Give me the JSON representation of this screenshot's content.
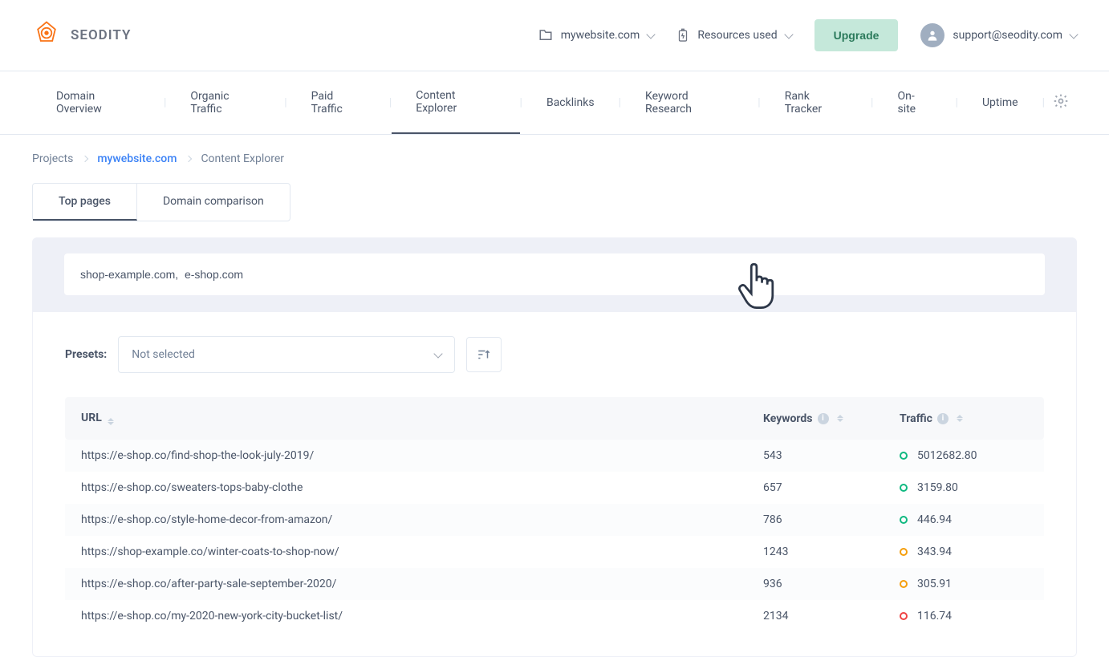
{
  "brand": "SEODITY",
  "header": {
    "domain": "mywebsite.com",
    "resources": "Resources used",
    "upgrade": "Upgrade",
    "user": "support@seodity.com"
  },
  "nav": [
    "Domain Overview",
    "Organic Traffic",
    "Paid Traffic",
    "Content Explorer",
    "Backlinks",
    "Keyword Research",
    "Rank Tracker",
    "On-site",
    "Uptime"
  ],
  "nav_active_index": 3,
  "breadcrumb": {
    "projects": "Projects",
    "domain": "mywebsite.com",
    "page": "Content Explorer"
  },
  "tabs": {
    "top_pages": "Top pages",
    "domain_comparison": "Domain comparison"
  },
  "search_value": "shop-example.com,  e-shop.com",
  "presets": {
    "label": "Presets:",
    "selected": "Not selected"
  },
  "table": {
    "headers": {
      "url": "URL",
      "keywords": "Keywords",
      "traffic": "Traffic"
    },
    "rows": [
      {
        "url": "https://e-shop.co/find-shop-the-look-july-2019/",
        "keywords": "543",
        "traffic": "5012682.80",
        "status": "green"
      },
      {
        "url": "https://e-shop.co/sweaters-tops-baby-clothe",
        "keywords": "657",
        "traffic": "3159.80",
        "status": "green"
      },
      {
        "url": "https://e-shop.co/style-home-decor-from-amazon/",
        "keywords": "786",
        "traffic": "446.94",
        "status": "green"
      },
      {
        "url": "https://shop-example.co/winter-coats-to-shop-now/",
        "keywords": "1243",
        "traffic": "343.94",
        "status": "yellow"
      },
      {
        "url": "https://e-shop.co/after-party-sale-september-2020/",
        "keywords": "936",
        "traffic": "305.91",
        "status": "yellow"
      },
      {
        "url": "https://e-shop.co/my-2020-new-york-city-bucket-list/",
        "keywords": "2134",
        "traffic": "116.74",
        "status": "red"
      }
    ]
  }
}
